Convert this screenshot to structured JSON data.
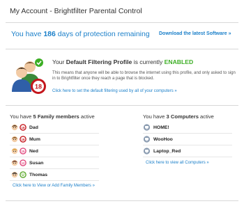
{
  "header": {
    "title": "My Account - Brightfilter Parental Control"
  },
  "protection": {
    "prefix": "You have ",
    "days": "186",
    "suffix": " days of protection remaining",
    "download_link": "Download the latest Software »"
  },
  "profile": {
    "heading_prefix": "Your ",
    "heading_strong": "Default Filtering Profile",
    "heading_middle": " is currently ",
    "status": "ENABLED",
    "description": "This means that anyone will be able to browse the internet using this profile, and only asked to sign in to Brightfilter once they reach a page that is blocked.",
    "link": "Click here to set the default filtering used by all of your computers »",
    "badge_text": "18",
    "status_color": "#3cae24"
  },
  "family": {
    "heading_prefix": "You have ",
    "heading_count": "5 Family members",
    "heading_suffix": " active",
    "members": [
      {
        "name": "Dad",
        "rating": "18",
        "rating_color": "#c4161c",
        "avatar": "adult-avatar-icon"
      },
      {
        "name": "Mum",
        "rating": "18",
        "rating_color": "#c4161c",
        "avatar": "adult-avatar-icon"
      },
      {
        "name": "Ned",
        "rating": "15",
        "rating_color": "#e0457b",
        "avatar": "child-avatar-icon"
      },
      {
        "name": "Susan",
        "rating": "12",
        "rating_color": "#e0457b",
        "avatar": "child-avatar-icon"
      },
      {
        "name": "Thomas",
        "rating": "U",
        "rating_color": "#5aa82a",
        "avatar": "child-avatar-icon"
      }
    ],
    "link": "Click here to View or Add Family Members »"
  },
  "computers": {
    "heading_prefix": "You have ",
    "heading_count": "3 Computers",
    "heading_suffix": " active",
    "items": [
      {
        "name": "HOME!"
      },
      {
        "name": "WooHoo"
      },
      {
        "name": "Laptop_Red"
      }
    ],
    "link": "Click here to view all Computers »"
  },
  "colors": {
    "link": "#1a7fc9",
    "enabled": "#3cae24",
    "divider": "#d8d8d8"
  }
}
